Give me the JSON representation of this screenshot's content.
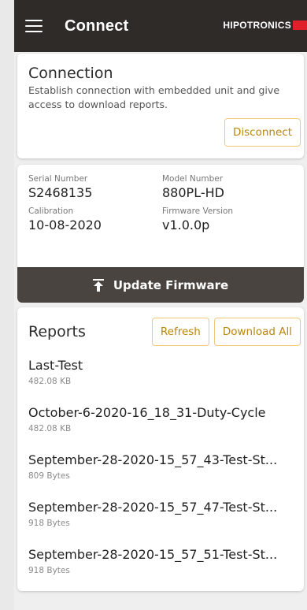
{
  "appbar": {
    "title": "Connect",
    "brand": "HIPOTRONICS",
    "brand_color": "#e11f2a",
    "menu_icon": "hamburger-menu-icon"
  },
  "connection": {
    "title": "Connection",
    "description": "Establish connection with embedded unit and give access to download reports.",
    "disconnect_label": "Disconnect"
  },
  "device": {
    "serial_label": "Serial Number",
    "serial_value": "S2468135",
    "model_label": "Model Number",
    "model_value": "880PL-HD",
    "calibration_label": "Calibration",
    "calibration_value": "10-08-2020",
    "firmware_label": "Firmware Version",
    "firmware_value": "v1.0.0p"
  },
  "update": {
    "label": "Update Firmware",
    "icon": "upload-icon"
  },
  "reports": {
    "title": "Reports",
    "refresh_label": "Refresh",
    "download_all_label": "Download All",
    "items": [
      {
        "name": "Last-Test",
        "size": "482.08 KB"
      },
      {
        "name": "October-6-2020-16_18_31-Duty-Cycle",
        "size": "482.08 KB"
      },
      {
        "name": "September-28-2020-15_57_43-Test-St...",
        "size": "809 Bytes"
      },
      {
        "name": "September-28-2020-15_57_47-Test-St...",
        "size": "918 Bytes"
      },
      {
        "name": "September-28-2020-15_57_51-Test-St...",
        "size": "918 Bytes"
      }
    ]
  },
  "colors": {
    "appbar_bg": "#2f2b29",
    "update_bar_bg": "#4a4440",
    "button_accent": "#b8860b",
    "button_border": "#f0c878"
  }
}
